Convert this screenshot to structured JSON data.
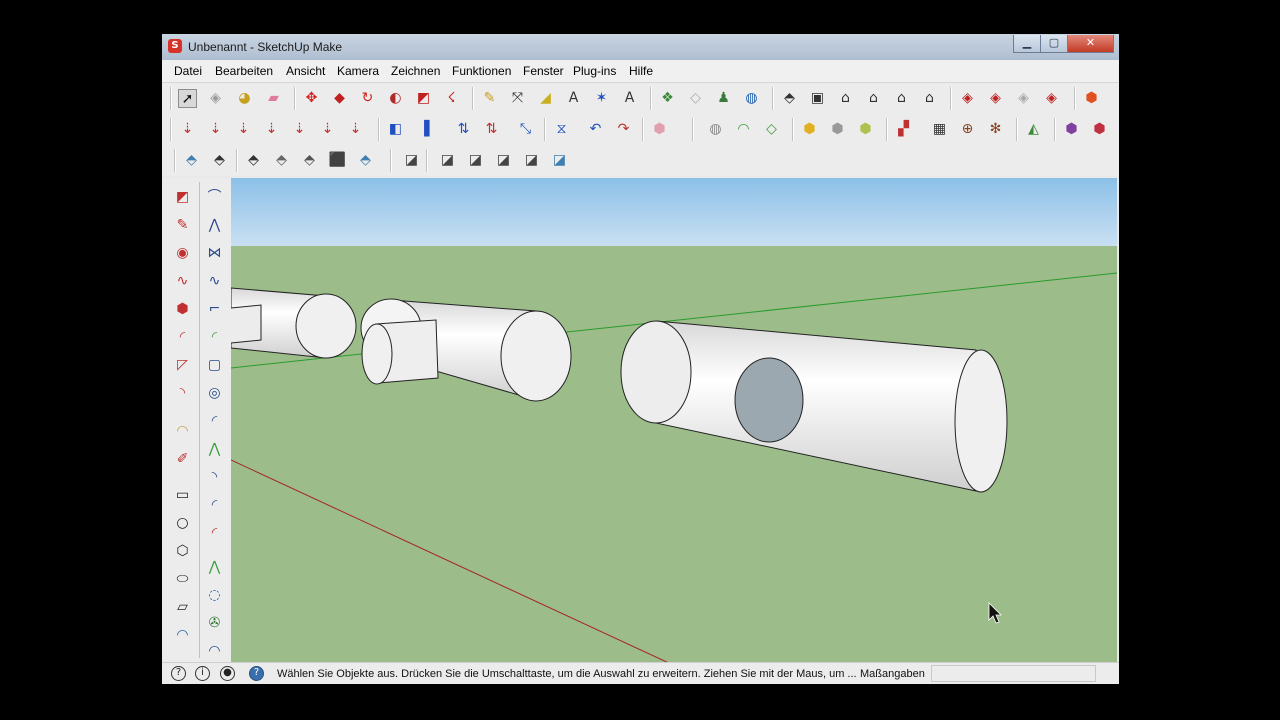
{
  "window": {
    "title": "Unbenannt - SketchUp Make",
    "app_icon_glyph": "S",
    "controls": {
      "minimize": "▁",
      "maximize": "▢",
      "close": "✕"
    }
  },
  "menu": [
    {
      "label": "Datei"
    },
    {
      "label": "Bearbeiten"
    },
    {
      "label": "Ansicht"
    },
    {
      "label": "Kamera"
    },
    {
      "label": "Zeichnen"
    },
    {
      "label": "Funktionen"
    },
    {
      "label": "Fenster"
    },
    {
      "label": "Plug-ins"
    },
    {
      "label": "Hilfe"
    }
  ],
  "toolbar_row1": [
    {
      "name": "select-arrow-icon",
      "glyph": "➚",
      "color": "#111111"
    },
    {
      "name": "make-component-icon",
      "glyph": "◈",
      "color": "#9a9a9a"
    },
    {
      "name": "paint-bucket-icon",
      "glyph": "◕",
      "color": "#c8a020"
    },
    {
      "name": "eraser-icon",
      "glyph": "▰",
      "color": "#e07aa0"
    },
    {
      "name": "move-icon",
      "glyph": "✥",
      "color": "#d02020"
    },
    {
      "name": "push-pull-icon",
      "glyph": "◆",
      "color": "#c02020"
    },
    {
      "name": "rotate-icon",
      "glyph": "↻",
      "color": "#d02020"
    },
    {
      "name": "follow-me-icon",
      "glyph": "◐",
      "color": "#b02a2a"
    },
    {
      "name": "scale-icon",
      "glyph": "◩",
      "color": "#c02020"
    },
    {
      "name": "offset-icon",
      "glyph": "☇",
      "color": "#c02020"
    },
    {
      "name": "tape-measure-icon",
      "glyph": "✎",
      "color": "#c8a020"
    },
    {
      "name": "dimensions-icon",
      "glyph": "⤧",
      "color": "#333333"
    },
    {
      "name": "protractor-icon",
      "glyph": "◢",
      "color": "#c8b020"
    },
    {
      "name": "text-icon",
      "glyph": "A",
      "color": "#333333"
    },
    {
      "name": "axes-icon",
      "glyph": "✶",
      "color": "#2050c0"
    },
    {
      "name": "3d-text-icon",
      "glyph": "A",
      "color": "#333333"
    },
    {
      "name": "orbit-icon",
      "glyph": "❖",
      "color": "#3a8a3a"
    },
    {
      "name": "section-plane-icon",
      "glyph": "◇",
      "color": "#aaaaaa"
    },
    {
      "name": "walk-icon",
      "glyph": "♟",
      "color": "#3a7a3a"
    },
    {
      "name": "get-models-icon",
      "glyph": "◍",
      "color": "#2060b0"
    },
    {
      "name": "iso-view-icon",
      "glyph": "⬘",
      "color": "#333333"
    },
    {
      "name": "top-view-icon",
      "glyph": "▣",
      "color": "#333333"
    },
    {
      "name": "front-view-icon",
      "glyph": "⌂",
      "color": "#333333"
    },
    {
      "name": "right-view-icon",
      "glyph": "⌂",
      "color": "#333333"
    },
    {
      "name": "back-view-icon",
      "glyph": "⌂",
      "color": "#333333"
    },
    {
      "name": "left-view-icon",
      "glyph": "⌂",
      "color": "#333333"
    },
    {
      "name": "3d-warehouse-icon",
      "glyph": "◈",
      "color": "#c02020"
    },
    {
      "name": "share-model-icon",
      "glyph": "◈",
      "color": "#c02020"
    },
    {
      "name": "share-component-icon",
      "glyph": "◈",
      "color": "#aaaaaa"
    },
    {
      "name": "extension-warehouse-icon",
      "glyph": "◈",
      "color": "#c02020"
    },
    {
      "name": "ruby-icon",
      "glyph": "⬢",
      "color": "#e05020"
    }
  ],
  "toolbar_row2": [
    {
      "name": "sandbox-from-contours-icon",
      "glyph": "⇣",
      "color": "#c03030"
    },
    {
      "name": "sandbox-smoove-icon",
      "glyph": "⇣",
      "color": "#c03030"
    },
    {
      "name": "sandbox-ar-icon",
      "glyph": "⇣",
      "color": "#c03030"
    },
    {
      "name": "sandbox-av-icon",
      "glyph": "⇣",
      "color": "#c03030"
    },
    {
      "name": "sandbox-an-icon",
      "glyph": "⇣",
      "color": "#c03030"
    },
    {
      "name": "sandbox-ax-icon",
      "glyph": "⇣",
      "color": "#c03030"
    },
    {
      "name": "sandbox-af-icon",
      "glyph": "⇣",
      "color": "#c03030"
    },
    {
      "name": "hide-plane-icon",
      "glyph": "◧",
      "color": "#2050c0"
    },
    {
      "name": "show-plane-icon",
      "glyph": "▌",
      "color": "#2050c0"
    },
    {
      "name": "flip-vertical-icon",
      "glyph": "⇅",
      "color": "#2050c0"
    },
    {
      "name": "flip-red-icon",
      "glyph": "⇅",
      "color": "#c03030"
    },
    {
      "name": "stretch-icon",
      "glyph": "⤡",
      "color": "#2050c0"
    },
    {
      "name": "mirror-icon",
      "glyph": "⧖",
      "color": "#2050c0"
    },
    {
      "name": "undo-icon",
      "glyph": "↶",
      "color": "#2050c0"
    },
    {
      "name": "redo-icon",
      "glyph": "↷",
      "color": "#c03030"
    },
    {
      "name": "cube-pink-icon",
      "glyph": "⬢",
      "color": "#e0a0b0"
    },
    {
      "name": "solid-shell-icon",
      "glyph": "◍",
      "color": "#888888"
    },
    {
      "name": "solid-intersect-icon",
      "glyph": "◠",
      "color": "#3a9a3a"
    },
    {
      "name": "solid-union-icon",
      "glyph": "◇",
      "color": "#3a9a3a"
    },
    {
      "name": "solid-cube-yellow-icon",
      "glyph": "⬢",
      "color": "#e0b020"
    },
    {
      "name": "solid-cube-white-icon",
      "glyph": "⬢",
      "color": "#999999"
    },
    {
      "name": "solid-cube-green-icon",
      "glyph": "⬢",
      "color": "#b0c050"
    },
    {
      "name": "book-icon",
      "glyph": "▞",
      "color": "#c03030"
    },
    {
      "name": "grid-icon",
      "glyph": "▦",
      "color": "#333333"
    },
    {
      "name": "target-icon",
      "glyph": "⊕",
      "color": "#884422"
    },
    {
      "name": "spokes-icon",
      "glyph": "✻",
      "color": "#884422"
    },
    {
      "name": "mirror-split-icon",
      "glyph": "◭",
      "color": "#3a8a3a"
    },
    {
      "name": "cube-blue-red-icon",
      "glyph": "⬢",
      "color": "#8040a0"
    },
    {
      "name": "cube-red-icon",
      "glyph": "⬢",
      "color": "#c03040"
    }
  ],
  "toolbar_row3": [
    {
      "name": "xray-icon",
      "glyph": "⬘",
      "color": "#4080b0"
    },
    {
      "name": "back-edges-icon",
      "glyph": "⬘",
      "color": "#333333"
    },
    {
      "name": "wireframe-icon",
      "glyph": "⬘",
      "color": "#333333"
    },
    {
      "name": "hidden-line-icon",
      "glyph": "⬘",
      "color": "#666666"
    },
    {
      "name": "shaded-icon",
      "glyph": "⬘",
      "color": "#555555"
    },
    {
      "name": "shaded-textures-icon",
      "glyph": "⬛",
      "color": "#222222"
    },
    {
      "name": "monochrome-icon",
      "glyph": "⬘",
      "color": "#4080b0"
    },
    {
      "name": "face-style-1-icon",
      "glyph": "◪",
      "color": "#444444"
    },
    {
      "name": "face-style-2-icon",
      "glyph": "◪",
      "color": "#444444"
    },
    {
      "name": "face-style-3-icon",
      "glyph": "◪",
      "color": "#444444"
    },
    {
      "name": "face-style-4-icon",
      "glyph": "◪",
      "color": "#444444"
    },
    {
      "name": "face-style-5-icon",
      "glyph": "◪",
      "color": "#444444"
    },
    {
      "name": "face-style-6-icon",
      "glyph": "◪",
      "color": "#4080b0"
    }
  ],
  "left_tools_col1": [
    {
      "name": "rectangle-tool-icon",
      "glyph": "◩",
      "color": "#c03030"
    },
    {
      "name": "pencil-tool-icon",
      "glyph": "✎",
      "color": "#c03030"
    },
    {
      "name": "circle-tool-icon",
      "glyph": "◉",
      "color": "#c03030"
    },
    {
      "name": "freehand-tool-icon",
      "glyph": "∿",
      "color": "#c03030"
    },
    {
      "name": "polygon-tool-icon",
      "glyph": "⬢",
      "color": "#c03030"
    },
    {
      "name": "arc-tool-icon",
      "glyph": "◜",
      "color": "#c03030"
    },
    {
      "name": "pie-tool-icon",
      "glyph": "◸",
      "color": "#c03030"
    },
    {
      "name": "2-point-arc-icon",
      "glyph": "◝",
      "color": "#c03030"
    },
    {
      "name": "shape-tool-icon",
      "glyph": "◠",
      "color": "#c8a040"
    },
    {
      "name": "pencil-eraser-icon",
      "glyph": "✐",
      "color": "#c03030"
    },
    {
      "name": "pipe-rect-icon",
      "glyph": "▭",
      "color": "#222222"
    },
    {
      "name": "pipe-circle-icon",
      "glyph": "○",
      "color": "#222222"
    },
    {
      "name": "pipe-hexagon-icon",
      "glyph": "⬡",
      "color": "#222222"
    },
    {
      "name": "pipe-ellipse-icon",
      "glyph": "⬭",
      "color": "#222222"
    },
    {
      "name": "pipe-parallelogram-icon",
      "glyph": "▱",
      "color": "#222222"
    },
    {
      "name": "pipe-arc-icon",
      "glyph": "◠",
      "color": "#2060b0"
    }
  ],
  "left_tools_col2": [
    {
      "name": "bezier-tool-icon",
      "glyph": "⌒",
      "color": "#2a4a8a"
    },
    {
      "name": "polyline-tool-icon",
      "glyph": "⋀",
      "color": "#2a4a8a"
    },
    {
      "name": "spline-tool-icon",
      "glyph": "⋈",
      "color": "#2a4a8a"
    },
    {
      "name": "curve-tool-icon",
      "glyph": "∿",
      "color": "#2a4a8a"
    },
    {
      "name": "corner-tool-icon",
      "glyph": "⌐",
      "color": "#2a4a8a"
    },
    {
      "name": "fillet-tool-icon",
      "glyph": "◜",
      "color": "#3a9a3a"
    },
    {
      "name": "rounded-rect-icon",
      "glyph": "▢",
      "color": "#2a4a8a"
    },
    {
      "name": "spiral-tool-icon",
      "glyph": "◎",
      "color": "#2a4a8a"
    },
    {
      "name": "arc-curve-icon",
      "glyph": "◜",
      "color": "#2a4a8a"
    },
    {
      "name": "zigzag-tool-icon",
      "glyph": "⋀",
      "color": "#3a9a3a"
    },
    {
      "name": "hook-tool-icon",
      "glyph": "◝",
      "color": "#2a4a8a"
    },
    {
      "name": "blue-arc-icon",
      "glyph": "◜",
      "color": "#2a4a8a"
    },
    {
      "name": "red-arc-icon",
      "glyph": "◜",
      "color": "#c03030"
    },
    {
      "name": "green-zigzag-icon",
      "glyph": "⋀",
      "color": "#3a9a3a"
    },
    {
      "name": "dotted-circle-icon",
      "glyph": "◌",
      "color": "#2060b0"
    },
    {
      "name": "wrench-icon",
      "glyph": "✇",
      "color": "#3a7a3a"
    },
    {
      "name": "loop-tool-icon",
      "glyph": "◠",
      "color": "#2a4a8a"
    }
  ],
  "status": {
    "icon1": "?",
    "icon2": "i",
    "icon3": "●",
    "icon4": "?",
    "text": "Wählen Sie Objekte aus. Drücken Sie die Umschalttaste, um die Auswahl zu erweitern. Ziehen Sie mit der Maus, um ...",
    "measure_label": "Maßangaben",
    "measure_value": ""
  },
  "colors": {
    "sky_top": "#8cc0e8",
    "sky_bottom": "#c9e0f2",
    "ground": "#9cbd8a",
    "cylinder_face": "#f0f0f0",
    "hole_fill": "#9ba8b0",
    "axis_red": "#a52424",
    "axis_green": "#2a9a2a"
  }
}
